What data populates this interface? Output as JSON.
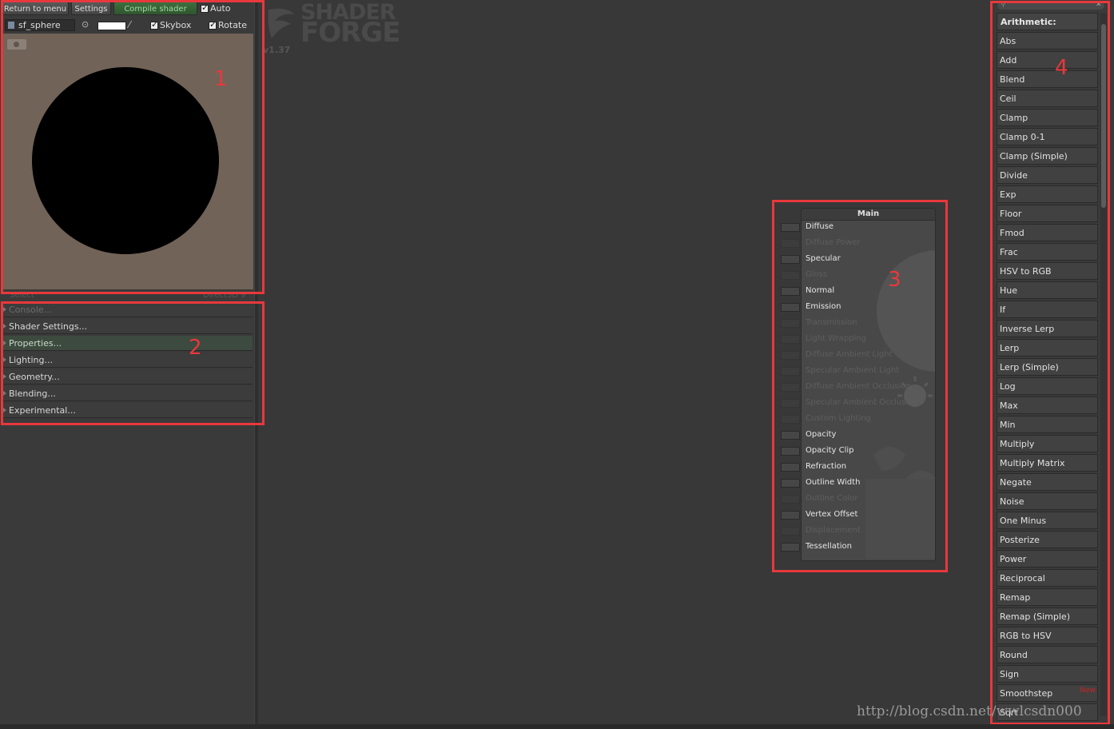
{
  "toolbar": {
    "return_label": "Return to menu",
    "settings_label": "Settings",
    "compile_label": "Compile shader",
    "auto_label": "Auto",
    "auto_checked": true
  },
  "preview_bar": {
    "mesh_name": "sf_sphere",
    "skybox_label": "Skybox",
    "rotate_label": "Rotate"
  },
  "status": {
    "left": "Select",
    "right": "Direct3D 9"
  },
  "settings_menu": {
    "items": [
      "Console...",
      "Shader Settings...",
      "Properties...",
      "Lighting...",
      "Geometry...",
      "Blending...",
      "Experimental..."
    ]
  },
  "logo": {
    "line1": "SHADER",
    "line2": "FORGE",
    "version": "v1.37"
  },
  "main_node": {
    "title": "Main",
    "inputs": [
      {
        "label": "Diffuse",
        "enabled": true
      },
      {
        "label": "Diffuse Power",
        "enabled": false
      },
      {
        "label": "Specular",
        "enabled": true
      },
      {
        "label": "Gloss",
        "enabled": false
      },
      {
        "label": "Normal",
        "enabled": true
      },
      {
        "label": "Emission",
        "enabled": true
      },
      {
        "label": "Transmission",
        "enabled": false
      },
      {
        "label": "Light Wrapping",
        "enabled": false
      },
      {
        "label": "Diffuse Ambient Light",
        "enabled": false
      },
      {
        "label": "Specular Ambient Light",
        "enabled": false
      },
      {
        "label": "Diffuse Ambient Occlusion",
        "enabled": false
      },
      {
        "label": "Specular Ambient Occlusion",
        "enabled": false
      },
      {
        "label": "Custom Lighting",
        "enabled": false
      },
      {
        "label": "Opacity",
        "enabled": true
      },
      {
        "label": "Opacity Clip",
        "enabled": true
      },
      {
        "label": "Refraction",
        "enabled": true
      },
      {
        "label": "Outline Width",
        "enabled": true
      },
      {
        "label": "Outline Color",
        "enabled": false
      },
      {
        "label": "Vertex Offset",
        "enabled": true
      },
      {
        "label": "Displacement",
        "enabled": false
      },
      {
        "label": "Tessellation",
        "enabled": true
      }
    ]
  },
  "node_list": {
    "category": "Arithmetic:",
    "items": [
      "Abs",
      "Add",
      "Blend",
      "Ceil",
      "Clamp",
      "Clamp 0-1",
      "Clamp (Simple)",
      "Divide",
      "Exp",
      "Floor",
      "Fmod",
      "Frac",
      "HSV to RGB",
      "Hue",
      "If",
      "Inverse Lerp",
      "Lerp",
      "Lerp (Simple)",
      "Log",
      "Max",
      "Min",
      "Multiply",
      "Multiply Matrix",
      "Negate",
      "Noise",
      "One Minus",
      "Posterize",
      "Power",
      "Reciprocal",
      "Remap",
      "Remap (Simple)",
      "RGB to HSV",
      "Round",
      "Sign",
      "Smoothstep",
      "Sqrt"
    ],
    "new_badge": "New",
    "new_badge_item": "Smoothstep"
  },
  "annotations": {
    "n1": "1",
    "n2": "2",
    "n3": "3",
    "n4": "4"
  },
  "watermark": "http://blog.csdn.net/wwlcsdn000",
  "colors": {
    "annotation_red": "#e8383c",
    "preview_bg": "#716358",
    "compile_green": "#3d6b3d"
  }
}
